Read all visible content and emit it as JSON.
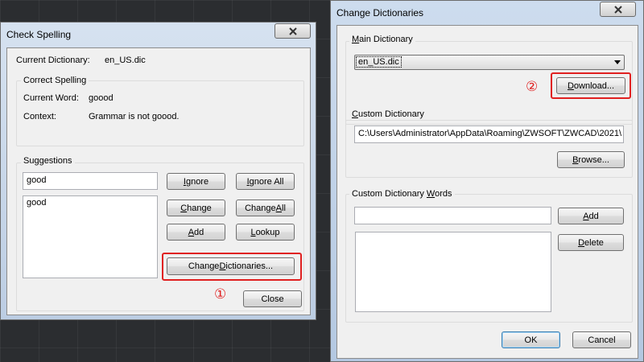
{
  "check_spelling": {
    "title": "Check Spelling",
    "close_icon": "close-x-icon",
    "current_dictionary_label": "Current Dictionary:",
    "current_dictionary_value": "en_US.dic",
    "correct_spelling_group": "Correct Spelling",
    "current_word_label": "Current Word:",
    "current_word_value": "goood",
    "context_label": "Context:",
    "context_value": "Grammar is not goood.",
    "suggestions_group": "Suggestions",
    "suggestion_input_value": "good",
    "suggestions_list": [
      "good"
    ],
    "buttons": {
      "ignore": {
        "pre": "",
        "key": "I",
        "post": "gnore"
      },
      "ignore_all": {
        "pre": "",
        "key": "I",
        "post": "gnore All"
      },
      "change": {
        "pre": "",
        "key": "C",
        "post": "hange"
      },
      "change_all": {
        "pre": "Change ",
        "key": "A",
        "post": "ll"
      },
      "add": {
        "pre": "",
        "key": "A",
        "post": "dd"
      },
      "lookup": {
        "pre": "",
        "key": "L",
        "post": "ookup"
      },
      "change_dictionaries": {
        "pre": "Change ",
        "key": "D",
        "post": "ictionaries..."
      },
      "close": "Close"
    },
    "step_marker": "①"
  },
  "change_dictionaries": {
    "title": "Change Dictionaries",
    "close_icon": "close-x-icon",
    "main_dictionary_group": {
      "pre": "",
      "key": "M",
      "post": "ain Dictionary"
    },
    "main_dictionary_selected": "en_US.dic",
    "download_button": {
      "pre": "",
      "key": "D",
      "post": "ownload..."
    },
    "step_marker": "②",
    "custom_dictionary_group": {
      "pre": "",
      "key": "C",
      "post": "ustom Dictionary"
    },
    "custom_dictionary_path": "C:\\Users\\Administrator\\AppData\\Roaming\\ZWSOFT\\ZWCAD\\2021\\",
    "browse_button": {
      "pre": "",
      "key": "B",
      "post": "rowse..."
    },
    "custom_words_group": {
      "pre": "Custom Dictionary ",
      "key": "W",
      "post": "ords"
    },
    "word_input_value": "",
    "words_list": [],
    "add_button": {
      "pre": "",
      "key": "A",
      "post": "dd"
    },
    "delete_button": {
      "pre": "",
      "key": "D",
      "post": "elete"
    },
    "ok_button": "OK",
    "cancel_button": "Cancel"
  },
  "colors": {
    "title_bar_gradient_start": "#c9d9ec",
    "title_bar_gradient_end": "#a9c0dc",
    "highlight": "#e02020",
    "desktop": "#2b2d30"
  }
}
